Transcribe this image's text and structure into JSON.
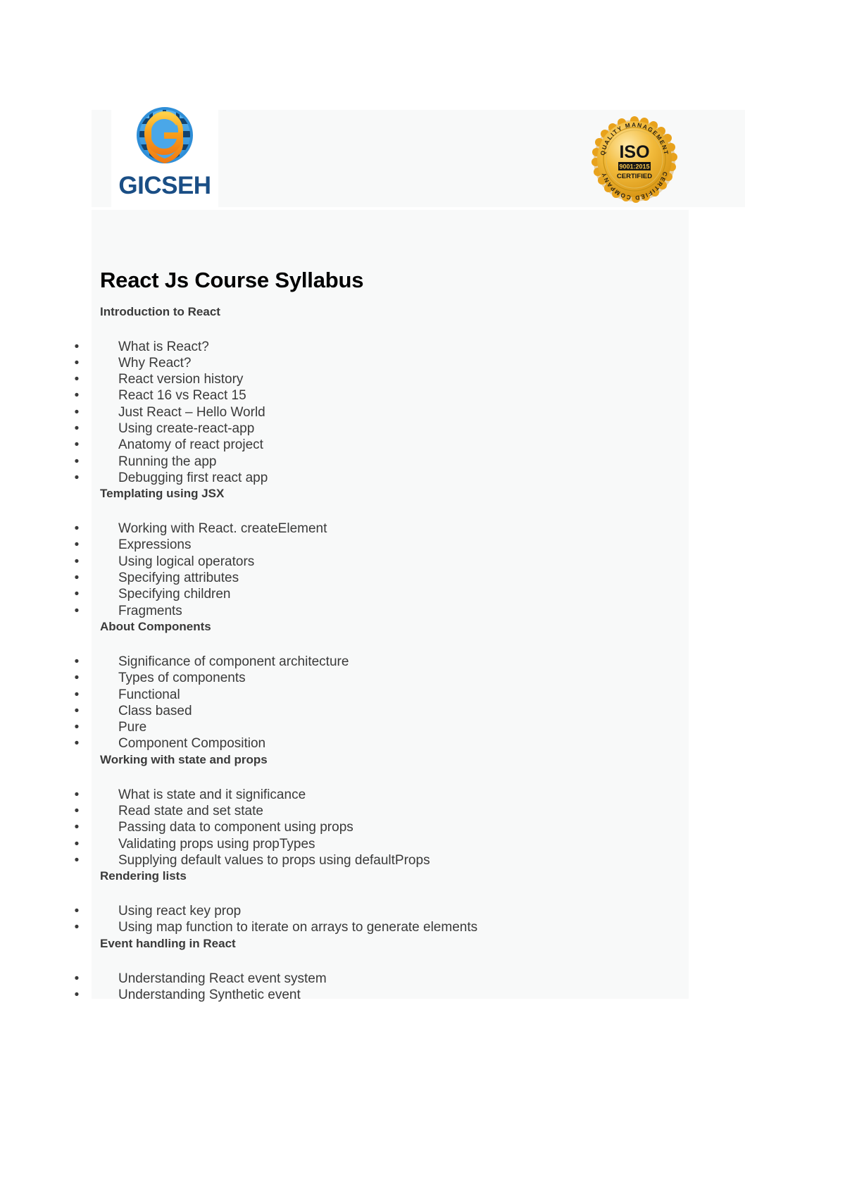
{
  "document": {
    "title": "React Js Course Syllabus"
  },
  "brand": {
    "name": "GICSEH",
    "logo_icon": "globe-shield-g-icon",
    "logo_colors": {
      "globe_light": "#4aa7e8",
      "globe_dark": "#11436f",
      "shield_orange": "#f6a01e",
      "wordmark": "#1a4e85"
    }
  },
  "certification": {
    "seal_icon": "iso-certification-seal-icon",
    "top_arc_text": "QUALITY MANAGEMENT",
    "main_text": "ISO",
    "standard": "9001:2015",
    "certified_text": "CERTIFIED",
    "bottom_arc_text": "CERTIFIED COMPANY",
    "seal_color": "#e8a21c"
  },
  "sections": [
    {
      "heading": "Introduction to React",
      "items": [
        "What is React?",
        "Why React?",
        "React version history",
        "React 16 vs React 15",
        "Just React – Hello World",
        "Using create-react-app",
        "Anatomy of react project",
        "Running the app",
        "Debugging first react app"
      ],
      "next_heading": "Templating using JSX"
    },
    {
      "heading": "Templating using JSX",
      "items": [
        "Working with React. createElement",
        "Expressions",
        "Using logical operators",
        "Specifying attributes",
        "Specifying children",
        "Fragments"
      ],
      "next_heading": "About Components"
    },
    {
      "heading": "About Components",
      "items": [
        "Significance of component architecture",
        "Types of components",
        "Functional",
        "Class based",
        "Pure",
        "Component Composition"
      ],
      "next_heading": "Working with state and props"
    },
    {
      "heading": "Working with state and props",
      "items": [
        "What is state and it significance",
        "Read state and set state",
        "Passing data to component using props",
        "Validating props using propTypes",
        "Supplying default values to props using defaultProps"
      ],
      "next_heading": "Rendering lists"
    },
    {
      "heading": "Rendering lists",
      "items": [
        "Using react key prop",
        "Using map function to iterate on arrays to generate elements"
      ],
      "next_heading": "Event handling in React"
    },
    {
      "heading": "Event handling in React",
      "items": [
        "Understanding React event system",
        "Understanding Synthetic event"
      ],
      "next_heading": ""
    }
  ],
  "bullet_glyph": "•"
}
